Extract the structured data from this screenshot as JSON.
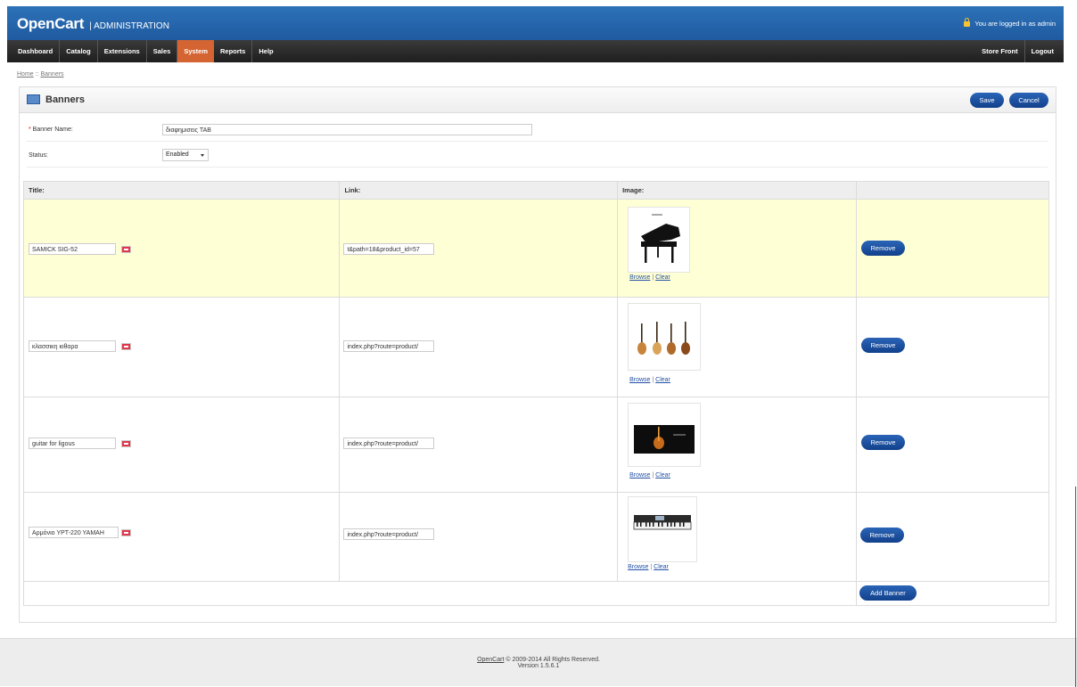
{
  "header": {
    "brand": "OpenCart",
    "brand_suffix": "| ADMINISTRATION",
    "logged_in_text": "You are logged in as admin"
  },
  "menu": {
    "items": [
      "Dashboard",
      "Catalog",
      "Extensions",
      "Sales",
      "System",
      "Reports",
      "Help"
    ],
    "active": "System",
    "right": [
      "Store Front",
      "Logout"
    ]
  },
  "breadcrumb": {
    "home": "Home",
    "separator": " :: ",
    "current": "Banners"
  },
  "page": {
    "title": "Banners",
    "save": "Save",
    "cancel": "Cancel"
  },
  "form": {
    "banner_name_label": "Banner Name:",
    "banner_name_value": "διαφημισεις TAB",
    "status_label": "Status:",
    "status_value": "Enabled"
  },
  "table": {
    "headers": [
      "Title:",
      "Link:",
      "Image:",
      ""
    ],
    "rows": [
      {
        "title": "SAMICK SIG-52",
        "link": "t&path=18&product_id=57",
        "image": "grand-piano",
        "highlighted": true
      },
      {
        "title": "κλασσικη κιθαρα",
        "link": "index.php?route=product/",
        "image": "guitars",
        "highlighted": false
      },
      {
        "title": "guitar for ligous",
        "link": "index.php?route=product/",
        "image": "guitar-banner",
        "highlighted": false
      },
      {
        "title": "Αρμόνιο YPT-220 YAMAH",
        "link": "index.php?route=product/",
        "image": "keyboard",
        "highlighted": false
      }
    ],
    "browse": "Browse",
    "link_sep": "|",
    "clear": "Clear",
    "remove": "Remove",
    "add_banner": "Add Banner"
  },
  "footer": {
    "brand_link": "OpenCart",
    "copyright": "© 2009-2014 All Rights Reserved.",
    "version": "Version 1.5.6.1"
  },
  "colors": {
    "header_blue": "#2d72b8",
    "menu_dark": "#2a2a2a",
    "menu_active": "#d46532",
    "button_blue": "#1a4f9e",
    "highlight_row": "#ffffd5"
  }
}
